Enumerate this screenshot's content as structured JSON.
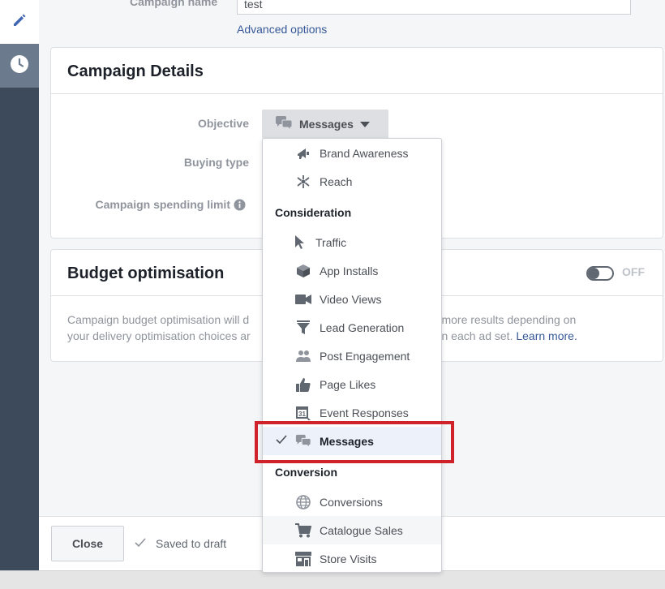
{
  "sidebar": {
    "edit_icon": "pencil-icon",
    "history_icon": "clock-icon"
  },
  "campaign_name": {
    "label": "Campaign name",
    "value": "test",
    "advanced_link": "Advanced options"
  },
  "campaign_details": {
    "title": "Campaign Details",
    "objective_label": "Objective",
    "buying_type_label": "Buying type",
    "spending_limit_label": "Campaign spending limit",
    "objective_value": "Messages"
  },
  "budget": {
    "title": "Budget optimisation",
    "toggle_state": "OFF",
    "description_line1_a": "Campaign budget optimisation will d",
    "description_line1_b": "ets to get more results depending on",
    "description_line2_a": "your delivery optimisation choices ar",
    "description_line2_b": "pending on each ad set.",
    "learn_more": "Learn more."
  },
  "menu": {
    "items": [
      {
        "label": "Brand Awareness",
        "icon": "megaphone-icon"
      },
      {
        "label": "Reach",
        "icon": "reach-icon"
      },
      {
        "header": "Consideration"
      },
      {
        "label": "Traffic",
        "icon": "cursor-icon"
      },
      {
        "label": "App Installs",
        "icon": "box-icon"
      },
      {
        "label": "Video Views",
        "icon": "video-icon"
      },
      {
        "label": "Lead Generation",
        "icon": "funnel-icon"
      },
      {
        "label": "Post Engagement",
        "icon": "people-icon"
      },
      {
        "label": "Page Likes",
        "icon": "thumbs-up-icon"
      },
      {
        "label": "Event Responses",
        "icon": "calendar-icon"
      },
      {
        "label": "Messages",
        "icon": "chat-icon",
        "selected": true
      },
      {
        "header": "Conversion"
      },
      {
        "label": "Conversions",
        "icon": "globe-icon"
      },
      {
        "label": "Catalogue Sales",
        "icon": "cart-icon"
      },
      {
        "label": "Store Visits",
        "icon": "store-icon"
      }
    ]
  },
  "footer": {
    "close_label": "Close",
    "saved_text": "Saved to draft"
  },
  "colors": {
    "sidebar": "#3c4a5c",
    "highlight": "#d0222a",
    "link": "#365899"
  }
}
